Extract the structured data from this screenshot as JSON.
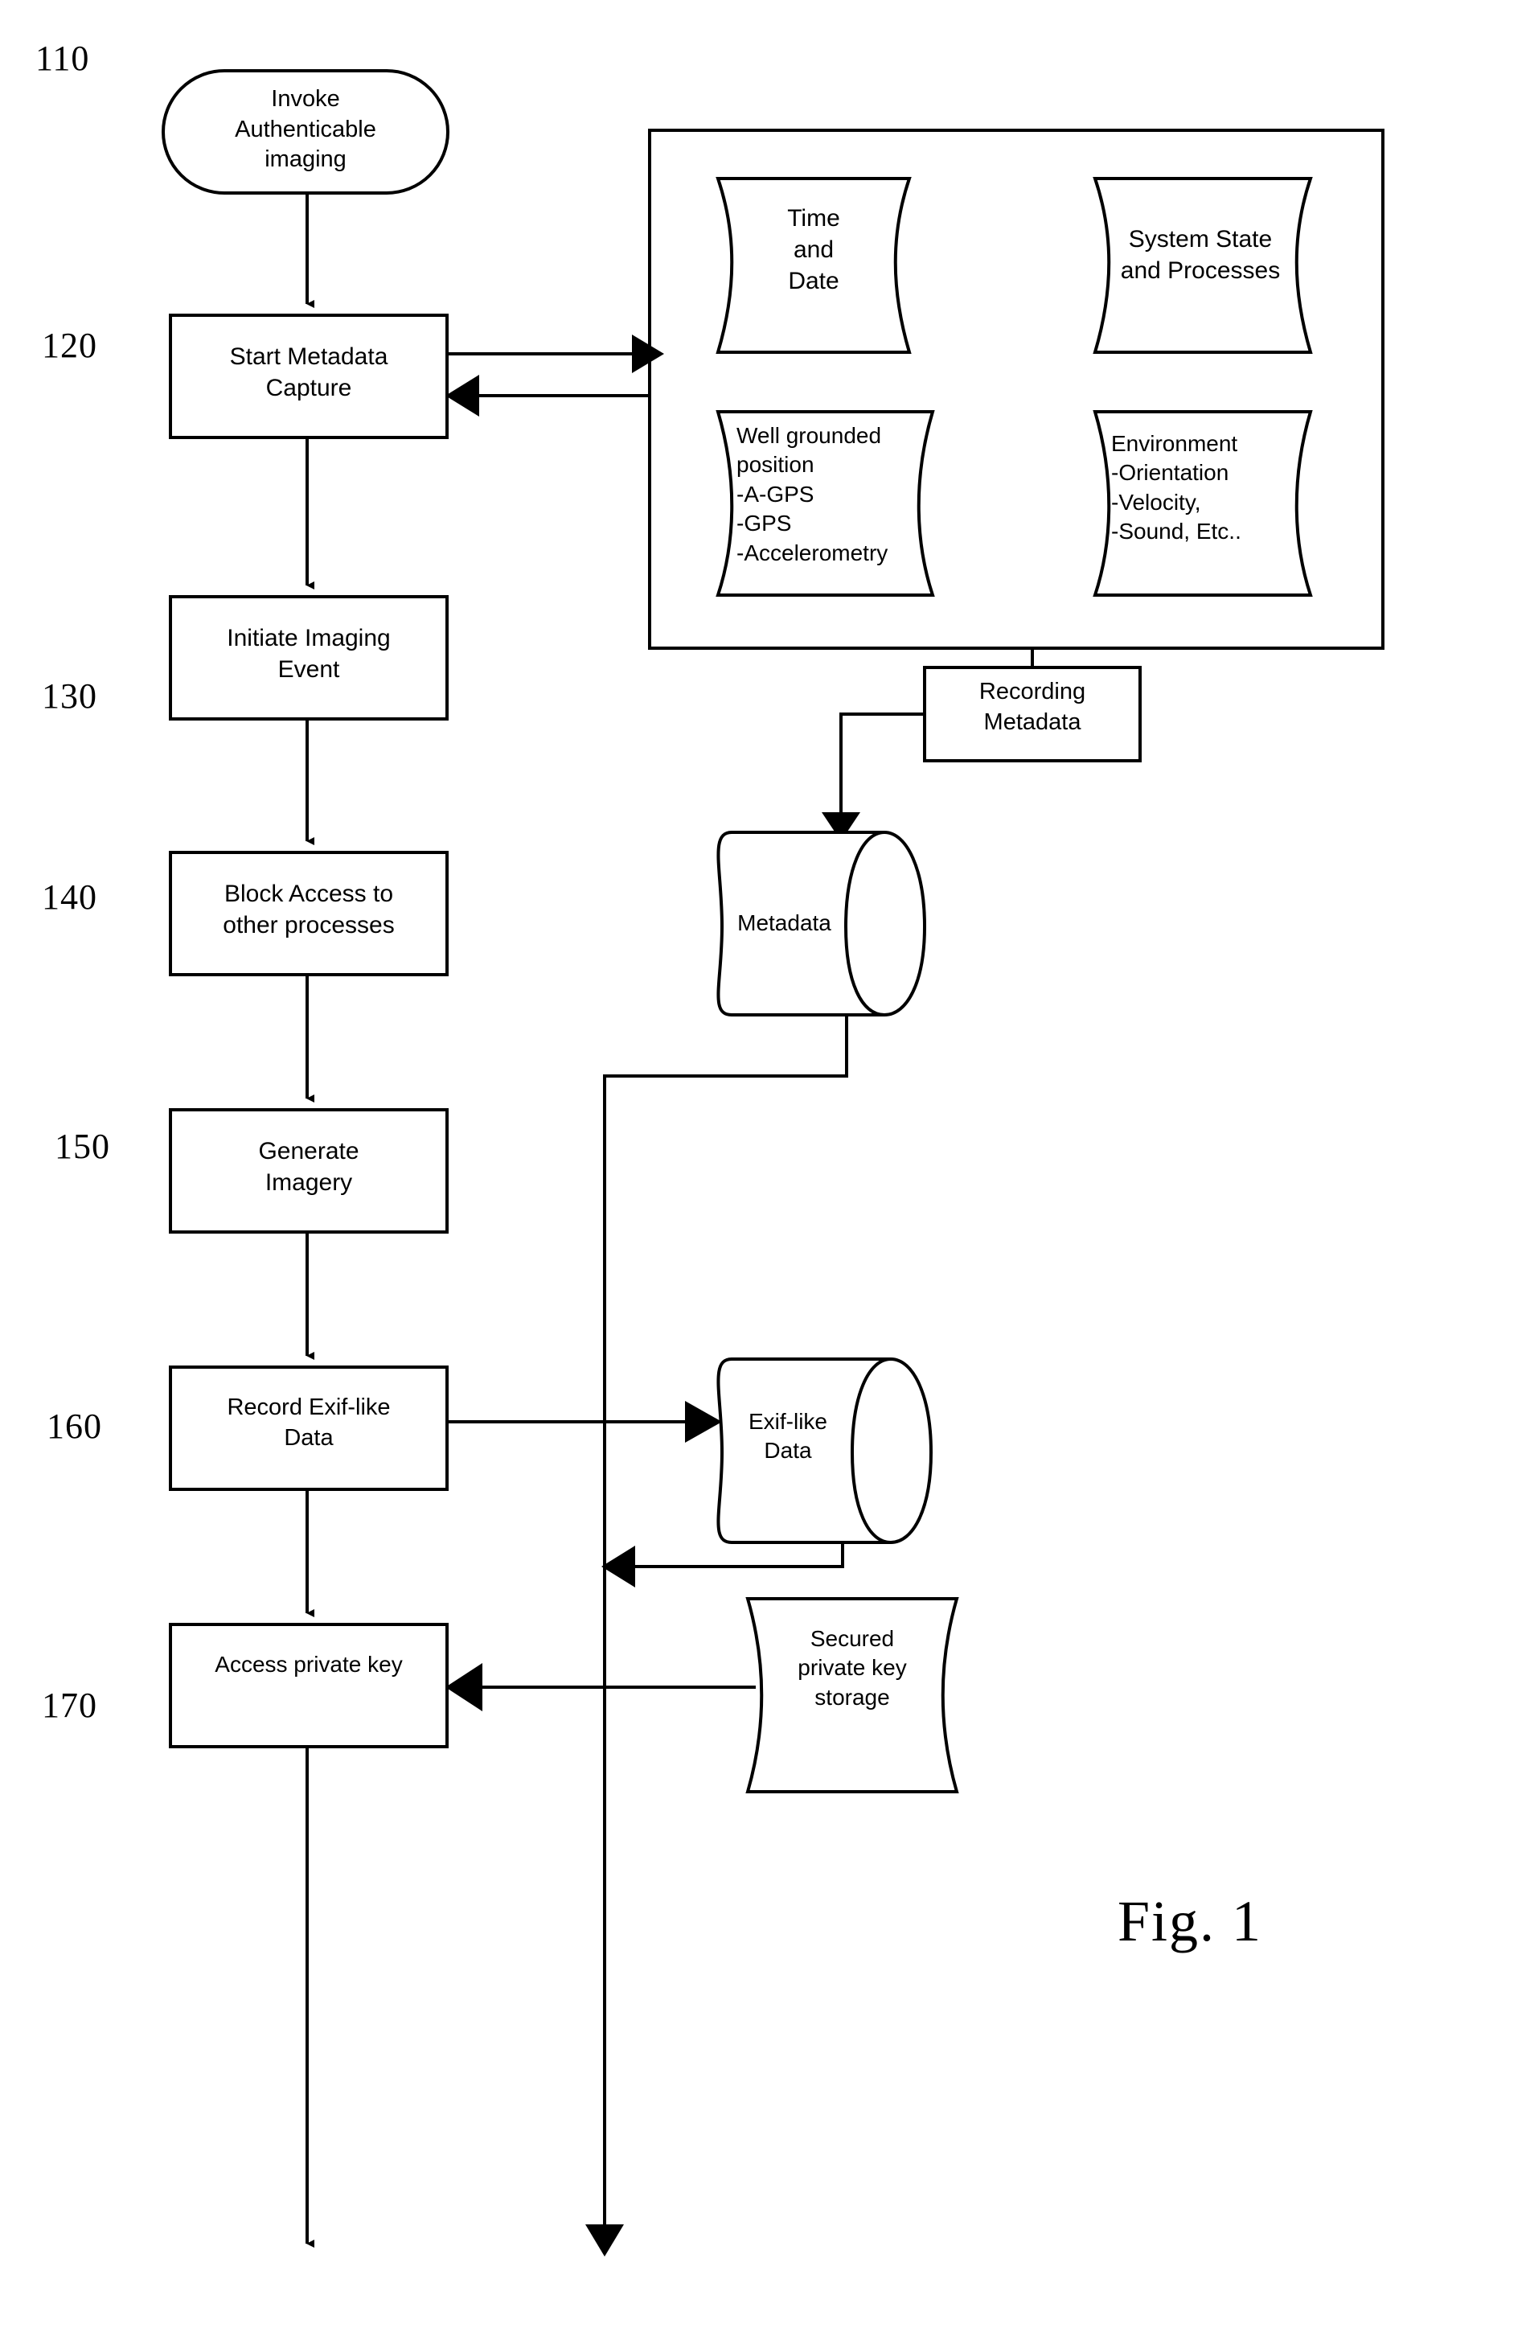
{
  "figure": {
    "caption": "Fig. 1"
  },
  "reference_numerals": [
    {
      "id": "110",
      "label": "110"
    },
    {
      "id": "120",
      "label": "120"
    },
    {
      "id": "130",
      "label": "130"
    },
    {
      "id": "140",
      "label": "140"
    },
    {
      "id": "150",
      "label": "150"
    },
    {
      "id": "160",
      "label": "160"
    },
    {
      "id": "170",
      "label": "170"
    }
  ],
  "nodes": {
    "invoke_authenticable_imaging": {
      "label": "Invoke\nAuthenticable\nimaging",
      "shape": "stadium"
    },
    "start_metadata_capture": {
      "label": "Start Metadata\nCapture",
      "shape": "rectangle"
    },
    "initiate_imaging_event": {
      "label": "Initiate Imaging\nEvent",
      "shape": "rectangle"
    },
    "block_access": {
      "label": "Block Access to\nother processes",
      "shape": "rectangle"
    },
    "generate_imagery": {
      "label": "Generate\nImagery",
      "shape": "rectangle"
    },
    "record_exif_like_data": {
      "label": "Record Exif-like\nData",
      "shape": "rectangle"
    },
    "access_private_key": {
      "label": "Access private key",
      "shape": "rectangle"
    },
    "recording_metadata": {
      "label": "Recording\nMetadata",
      "shape": "rectangle"
    },
    "time_and_date": {
      "label": "Time\nand\nDate",
      "shape": "curved-data-store"
    },
    "system_state_and_processes": {
      "label": "System State\nand Processes",
      "shape": "curved-data-store"
    },
    "well_grounded_position": {
      "label": "Well grounded\nposition\n-A-GPS\n-GPS\n-Accelerometry",
      "shape": "curved-data-store"
    },
    "environment": {
      "label": "Environment\n-Orientation\n-Velocity,\n-Sound, Etc..",
      "shape": "curved-data-store"
    },
    "metadata_store": {
      "label": "Metadata",
      "shape": "cylinder"
    },
    "exif_like_data_store": {
      "label": "Exif-like\nData",
      "shape": "cylinder"
    },
    "secured_private_key_storage": {
      "label": "Secured\nprivate key\nstorage",
      "shape": "curved-data-store"
    }
  },
  "metadata_panel": {
    "name": "metadata sources container"
  },
  "colors": {
    "stroke": "#000000",
    "fill": "#ffffff",
    "background": "#ffffff"
  }
}
